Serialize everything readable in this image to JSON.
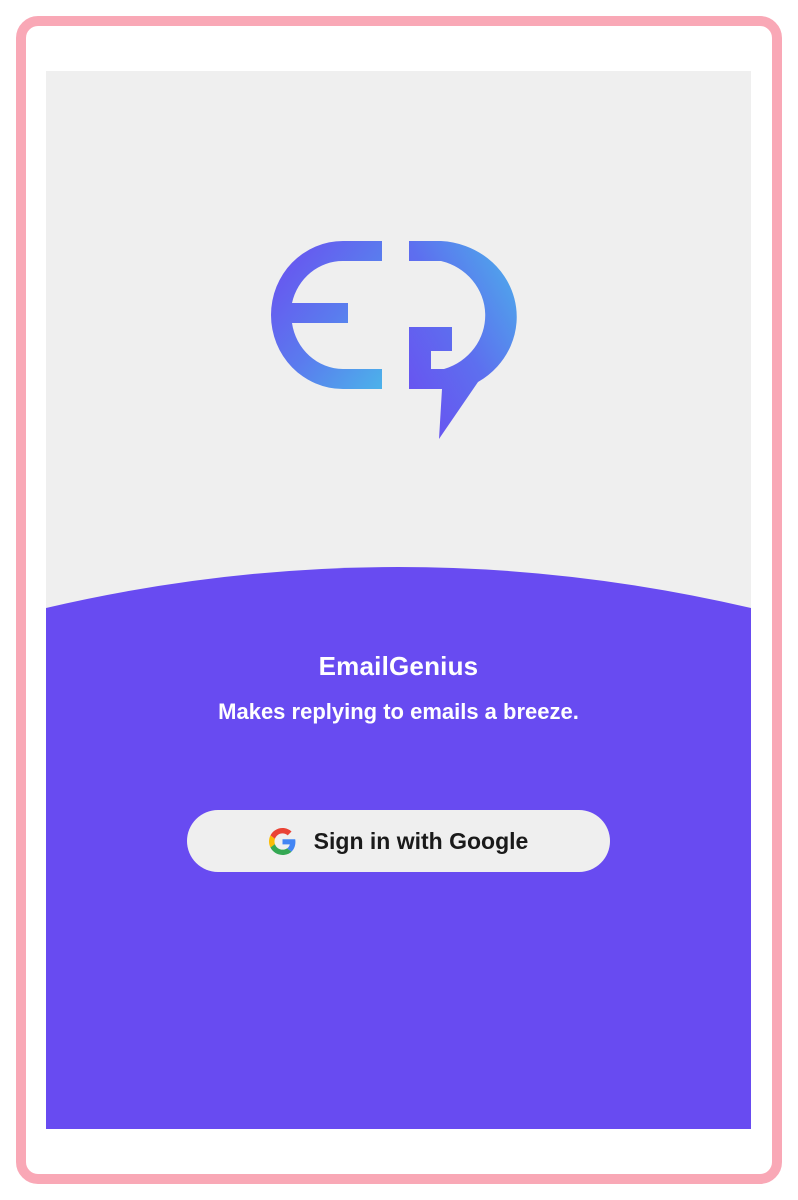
{
  "app": {
    "name": "EmailGenius",
    "tagline": "Makes replying to emails a breeze."
  },
  "signin": {
    "label": "Sign in with Google",
    "icon": "google-g-icon"
  },
  "logo": {
    "icon": "emailgenius-logo-icon"
  },
  "colors": {
    "frame_border": "#f9a8b6",
    "screen_bg": "#efefef",
    "brand_purple": "#684bf1",
    "logo_gradient_start": "#6b4cf0",
    "logo_gradient_end": "#4cb2ea",
    "button_bg": "#efefef",
    "button_text": "#1a1a1a"
  }
}
